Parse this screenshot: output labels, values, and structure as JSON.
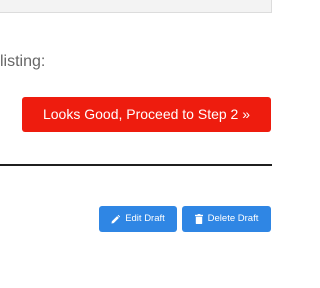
{
  "listing": {
    "label": "listing:"
  },
  "proceed": {
    "label": "Looks Good, Proceed to Step 2 »"
  },
  "actions": {
    "edit_label": "Edit Draft",
    "delete_label": "Delete Draft"
  },
  "colors": {
    "proceed_button": "#ee1c0e",
    "action_button": "#2f86e4",
    "divider": "#1f1f1f",
    "label_text": "#666666"
  },
  "icons": {
    "edit": "pencil-icon",
    "delete": "trash-icon"
  }
}
